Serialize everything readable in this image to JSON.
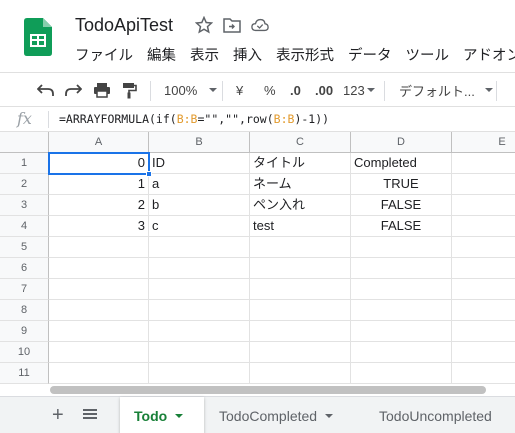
{
  "app": {
    "title": "TodoApiTest",
    "logo_icon": "google-sheets-icon",
    "title_icons": [
      "star-icon",
      "move-to-folder-icon",
      "cloud-status-icon"
    ]
  },
  "menu": [
    "ファイル",
    "編集",
    "表示",
    "挿入",
    "表示形式",
    "データ",
    "ツール",
    "アドオン"
  ],
  "toolbar": {
    "icons": [
      "undo-icon",
      "redo-icon",
      "print-icon",
      "paint-format-icon"
    ],
    "zoom": "100%",
    "currency": "¥",
    "percent": "%",
    "decrease_decimal": ".0",
    "increase_decimal": ".00",
    "more_formats": "123",
    "font": "デフォルト..."
  },
  "formula_bar": {
    "fx_label": "fx",
    "parts": [
      "=ARRAYFORMULA(if(",
      "B:B",
      "=\"\",\"\",row(",
      "B:B",
      ")-1))"
    ]
  },
  "grid": {
    "columns": [
      "A",
      "B",
      "C",
      "D",
      "E"
    ],
    "rows": [
      "1",
      "2",
      "3",
      "4",
      "5",
      "6",
      "7",
      "8",
      "9",
      "10",
      "11"
    ],
    "cells": [
      [
        "0",
        "ID",
        "タイトル",
        "Completed"
      ],
      [
        "1",
        "a",
        "ネーム",
        "TRUE"
      ],
      [
        "2",
        "b",
        "ペン入れ",
        "FALSE"
      ],
      [
        "3",
        "c",
        "test",
        "FALSE"
      ]
    ],
    "selected_cell": "A1"
  },
  "sheet_tabs": {
    "add_icon": "plus-icon",
    "list_icon": "all-sheets-icon",
    "tabs": [
      "Todo",
      "TodoCompleted",
      "TodoUncompleted"
    ],
    "active": "Todo",
    "active_color": "#188038"
  },
  "colors": {
    "brand_green": "#0f9d58",
    "selection_blue": "#1a73e8",
    "formula_ref": "#e29a2c"
  }
}
